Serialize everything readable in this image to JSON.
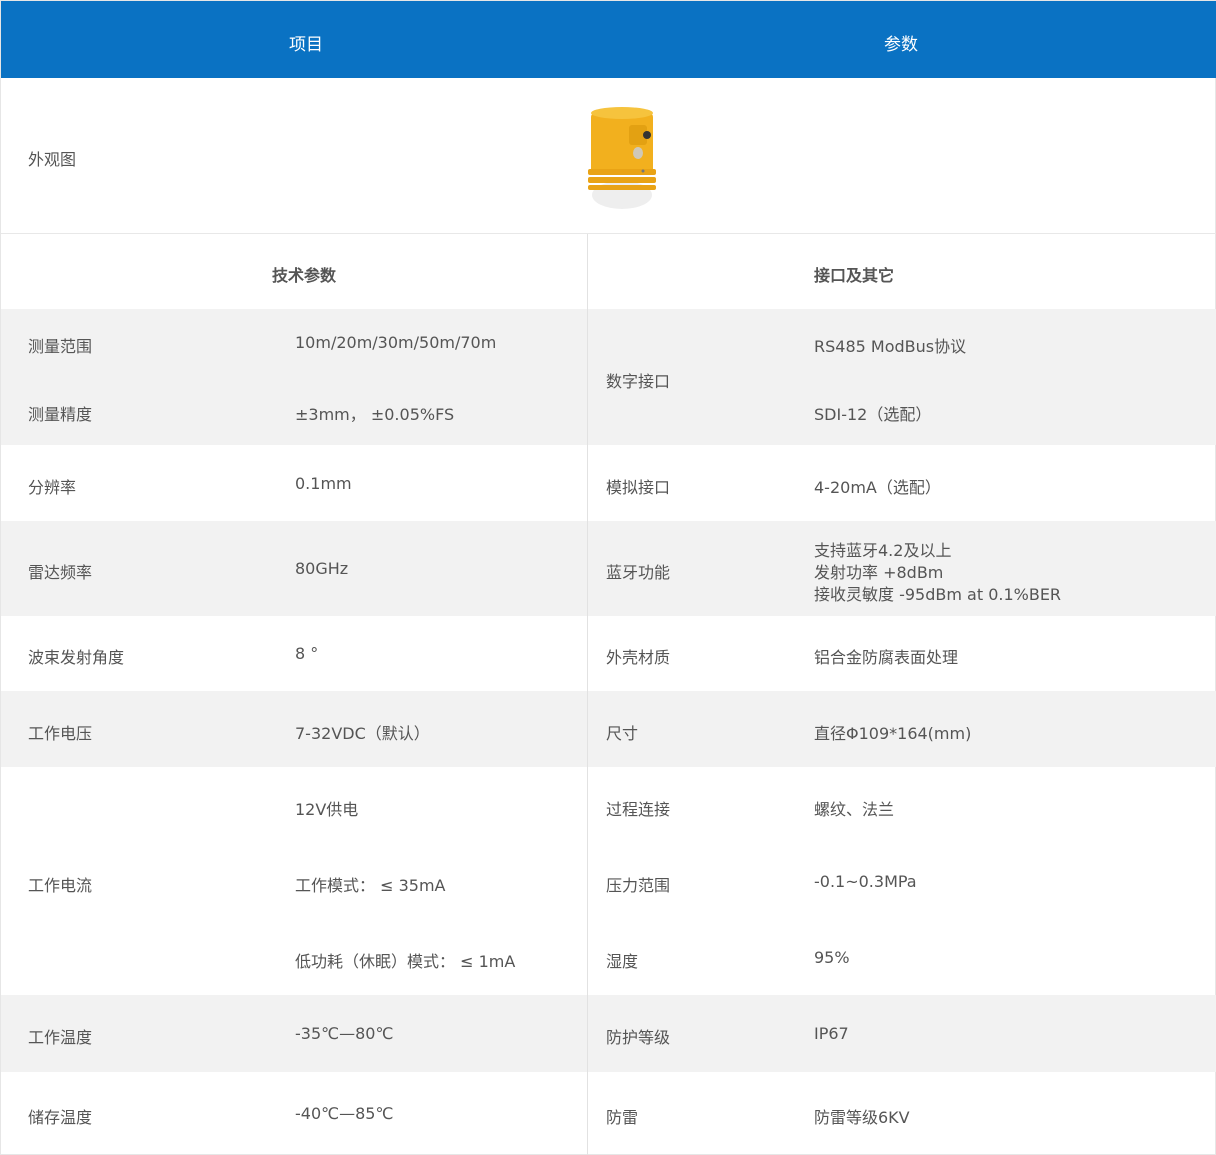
{
  "header": {
    "col1": "项目",
    "col2": "参数"
  },
  "appearance": {
    "label": "外观图",
    "image_icon": "yellow-radar-sensor"
  },
  "sections": {
    "tech": "技术参数",
    "interface": "接口及其它"
  },
  "rows": {
    "range": {
      "label": "测量范围",
      "value": "10m/20m/30m/50m/70m"
    },
    "accuracy": {
      "label": "测量精度",
      "value": "±3mm， ±0.05%FS"
    },
    "digital": {
      "label": "数字接口",
      "value1": "RS485 ModBus协议",
      "value2": "SDI-12（选配）"
    },
    "resolution": {
      "label": "分辨率",
      "value": "0.1mm"
    },
    "analog": {
      "label": "模拟接口",
      "value": "4-20mA（选配）"
    },
    "radar_freq": {
      "label": "雷达频率",
      "value": "80GHz"
    },
    "bluetooth": {
      "label": "蓝牙功能",
      "line1": "支持蓝牙4.2及以上",
      "line2": "发射功率 +8dBm",
      "line3": "接收灵敏度 -95dBm at 0.1%BER"
    },
    "beam": {
      "label": "波束发射角度",
      "value": "8 °"
    },
    "housing": {
      "label": "外壳材质",
      "value": "铝合金防腐表面处理"
    },
    "voltage": {
      "label": "工作电压",
      "value": "7-32VDC（默认）"
    },
    "size": {
      "label": "尺寸",
      "value": "直径Φ109*164(mm)"
    },
    "current": {
      "label": "工作电流",
      "line1": "12V供电",
      "line2": "工作模式： ≤ 35mA",
      "line3": "低功耗（休眠）模式： ≤ 1mA"
    },
    "process": {
      "label": "过程连接",
      "value": "螺纹、法兰"
    },
    "pressure": {
      "label": "压力范围",
      "value": "-0.1~0.3MPa"
    },
    "humidity": {
      "label": "湿度",
      "value": "95%"
    },
    "work_temp": {
      "label": "工作温度",
      "value": "-35℃—80℃"
    },
    "protection": {
      "label": "防护等级",
      "value": "IP67"
    },
    "storage_temp": {
      "label": "储存温度",
      "value": "-40℃—85℃"
    },
    "lightning": {
      "label": "防雷",
      "value": "防雷等级6KV"
    }
  },
  "colors": {
    "header_bg": "#0a72c3",
    "stripe": "#f2f2f2",
    "device": "#f2b01e"
  }
}
